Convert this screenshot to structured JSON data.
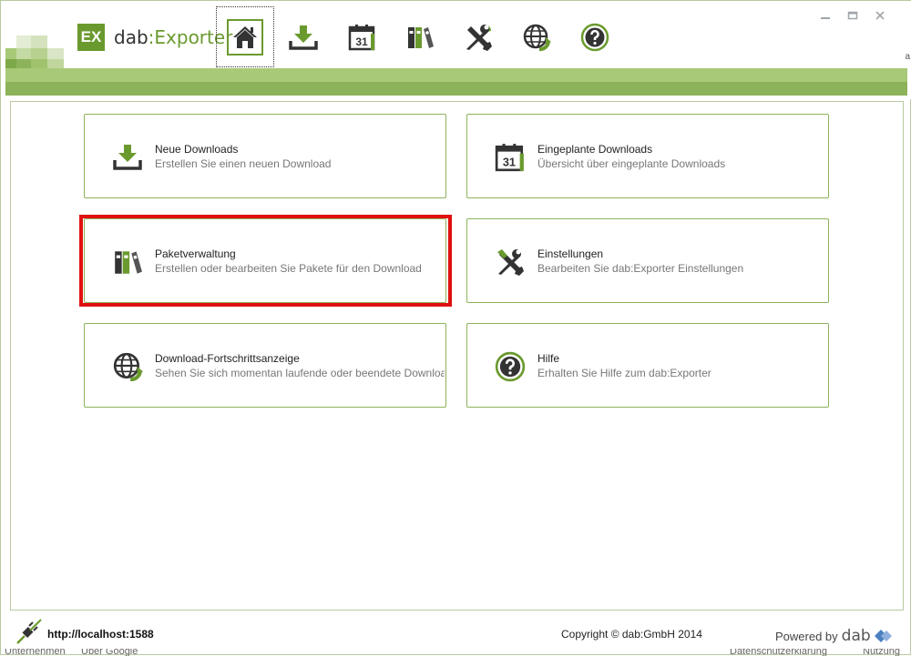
{
  "logo": {
    "badge": "EX",
    "name_prefix": "dab",
    "name_sep": ":",
    "name_suffix": "Exporter"
  },
  "toolbar": [
    {
      "id": "home",
      "icon": "home-icon",
      "active": true
    },
    {
      "id": "download",
      "icon": "download-icon",
      "active": false
    },
    {
      "id": "calendar",
      "icon": "calendar-icon",
      "active": false
    },
    {
      "id": "packages",
      "icon": "binders-icon",
      "active": false
    },
    {
      "id": "settings",
      "icon": "tools-icon",
      "active": false
    },
    {
      "id": "progress",
      "icon": "globe-refresh-icon",
      "active": false
    },
    {
      "id": "help",
      "icon": "help-icon",
      "active": false
    }
  ],
  "side_text": "a",
  "cards": [
    {
      "title": "Neue Downloads",
      "desc": "Erstellen Sie einen neuen Download",
      "icon": "download-icon"
    },
    {
      "title": "Eingeplante Downloads",
      "desc": "Übersicht über eingeplante Downloads",
      "icon": "calendar-icon",
      "calendar_day": "31"
    },
    {
      "title": "Paketverwaltung",
      "desc": "Erstellen oder bearbeiten Sie Pakete für den Download",
      "icon": "binders-icon"
    },
    {
      "title": "Einstellungen",
      "desc": "Bearbeiten Sie dab:Exporter Einstellungen",
      "icon": "tools-icon"
    },
    {
      "title": "Download-Fortschrittsanzeige",
      "desc": "Sehen Sie sich momentan laufende oder beendete Downloads an",
      "icon": "globe-refresh-icon"
    },
    {
      "title": "Hilfe",
      "desc": "Erhalten Sie Hilfe zum dab:Exporter",
      "icon": "help-icon"
    }
  ],
  "footer": {
    "url": "http://localhost:1588",
    "copyright": "Copyright © dab:GmbH 2014",
    "powered_by": "Powered by",
    "powered_brand": "dab"
  },
  "bottom_strip": [
    "Unternehmen",
    "Über Google",
    "Datenschutzerklärung",
    "Nutzung"
  ],
  "colors": {
    "accent": "#6a9a2e",
    "band": "#8db35a",
    "highlight": "#e01010"
  }
}
